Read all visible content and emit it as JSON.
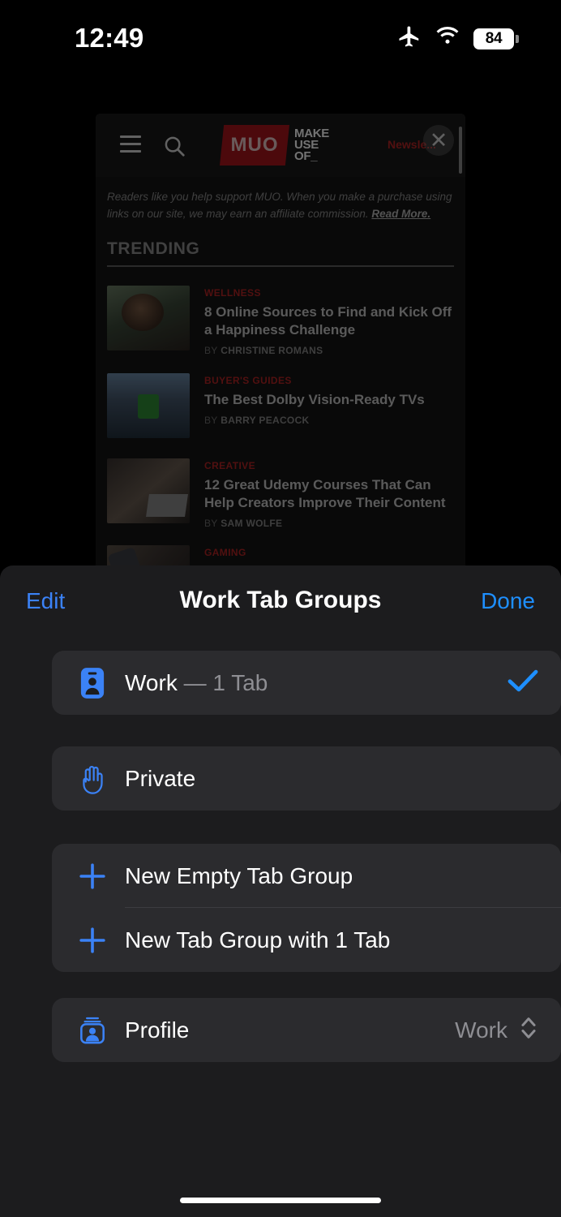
{
  "status_bar": {
    "time": "12:49",
    "icons": [
      "airplane-mode-icon",
      "wifi-icon",
      "battery-icon"
    ],
    "battery_percent": "84"
  },
  "webpage": {
    "site_name": "MUO",
    "logo_mark": "MUO",
    "logo_words": "MAKE USE OF_",
    "header_icons": [
      "hamburger-menu-icon",
      "search-icon",
      "close-icon"
    ],
    "newsletter_label": "Newsle...",
    "disclaimer": "Readers like you help support MUO. When you make a purchase using links on our site, we may earn an affiliate commission.",
    "disclaimer_link": "Read More.",
    "section_title": "TRENDING",
    "articles": [
      {
        "category": "WELLNESS",
        "title": "8 Online Sources to Find and Kick Off a Happiness Challenge",
        "byline_prefix": "BY",
        "author": "CHRISTINE ROMANS"
      },
      {
        "category": "BUYER'S GUIDES",
        "title": "The Best Dolby Vision-Ready TVs",
        "byline_prefix": "BY",
        "author": "BARRY PEACOCK"
      },
      {
        "category": "CREATIVE",
        "title": "12 Great Udemy Courses That Can Help Creators Improve Their Content",
        "byline_prefix": "BY",
        "author": "SAM WOLFE"
      },
      {
        "category": "GAMING",
        "title": "",
        "byline_prefix": "",
        "author": ""
      }
    ]
  },
  "sheet": {
    "edit_label": "Edit",
    "title": "Work Tab Groups",
    "done_label": "Done",
    "tab_groups": [
      {
        "icon": "id-card-icon",
        "name": "Work",
        "separator": "—",
        "count_label": "1 Tab",
        "selected": true,
        "check_icon": "checkmark-icon"
      },
      {
        "icon": "hand-raised-icon",
        "name": "Private",
        "separator": "",
        "count_label": "",
        "selected": false
      }
    ],
    "actions": [
      {
        "icon": "plus-icon",
        "label": "New Empty Tab Group"
      },
      {
        "icon": "plus-icon",
        "label": "New Tab Group with 1 Tab"
      }
    ],
    "profile": {
      "icon": "profile-card-icon",
      "label": "Profile",
      "value": "Work",
      "picker_icon": "chevron-up-down-icon"
    }
  },
  "colors": {
    "accent_blue": "#1e8fff",
    "edit_blue": "#3b82f6",
    "sheet_bg": "#1c1c1e",
    "row_bg": "#2b2b2e",
    "secondary_text": "#8e8e93",
    "brand_red": "#b32424"
  },
  "home_indicator": "home-indicator"
}
